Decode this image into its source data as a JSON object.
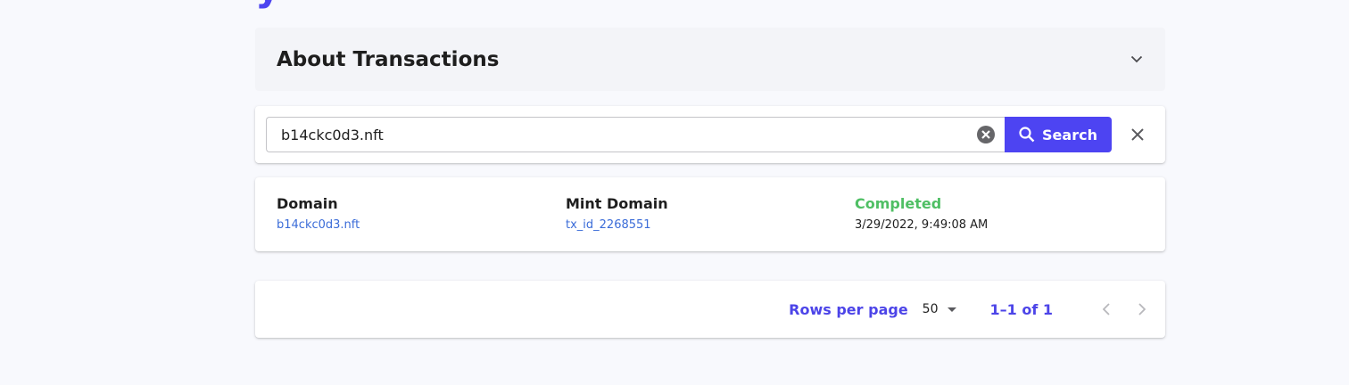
{
  "about": {
    "title": "About Transactions"
  },
  "search": {
    "value": "b14ckc0d3.nft",
    "button_label": "Search"
  },
  "result": {
    "domain_label": "Domain",
    "domain_value": "b14ckc0d3.nft",
    "mint_label": "Mint Domain",
    "mint_value": "tx_id_2268551",
    "status": "Completed",
    "timestamp": "3/29/2022, 9:49:08 AM"
  },
  "pagination": {
    "rows_label": "Rows per page",
    "rows_value": "50",
    "range": "1–1 of 1"
  },
  "colors": {
    "accent": "#4d44f2",
    "link": "#3b6cd8",
    "success": "#4fbf64"
  }
}
